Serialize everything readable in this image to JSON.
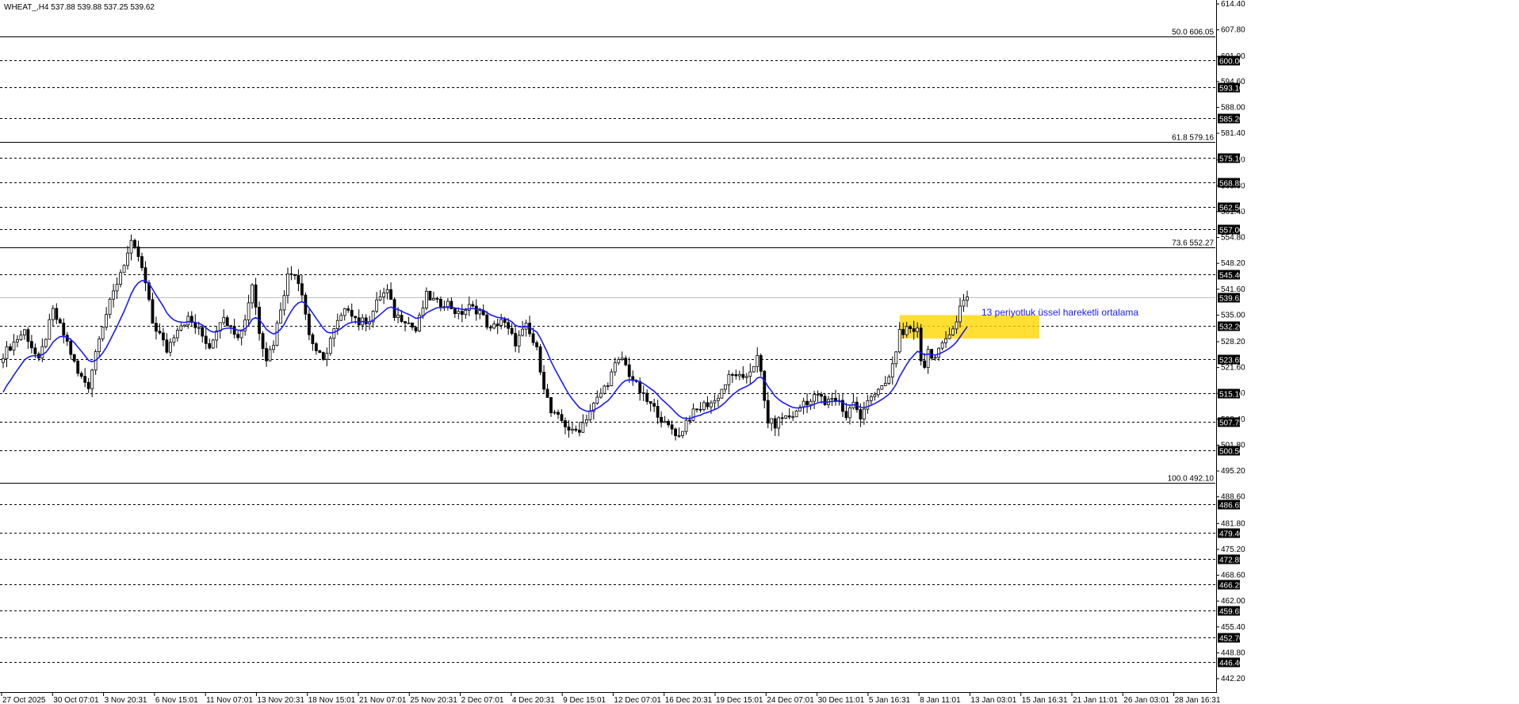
{
  "chart_data": {
    "type": "candlestick",
    "title": "WHEAT_,H4  537.88 539.88 537.25 539.62",
    "symbol": "WHEAT_,H4",
    "ohlc_readout": [
      "537.88",
      "539.88",
      "537.25",
      "539.62"
    ],
    "ylim": [
      442.0,
      614.4
    ],
    "price_axis_ticks": [
      "614.40",
      "607.80",
      "601.00",
      "594.60",
      "588.00",
      "581.40",
      "574.60",
      "568.00",
      "561.40",
      "554.80",
      "548.20",
      "541.60",
      "535.00",
      "528.20",
      "521.60",
      "515.00",
      "508.40",
      "501.80",
      "495.20",
      "488.60",
      "481.80",
      "475.20",
      "468.60",
      "462.00",
      "455.40",
      "448.80",
      "442.20"
    ],
    "x_tick_labels": [
      "27 Oct 2025",
      "30 Oct 07:01",
      "3 Nov 20:31",
      "6 Nov 15:01",
      "11 Nov 07:01",
      "13 Nov 20:31",
      "18 Nov 15:01",
      "21 Nov 07:01",
      "25 Nov 20:31",
      "2 Dec 07:01",
      "4 Dec 20:31",
      "9 Dec 15:01",
      "12 Dec 07:01",
      "16 Dec 20:31",
      "19 Dec 15:01",
      "24 Dec 07:01",
      "30 Dec 11:01",
      "5 Jan 16:31",
      "8 Jan 11:01",
      "13 Jan 03:01",
      "15 Jan 16:31",
      "21 Jan 11:01",
      "26 Jan 03:01",
      "28 Jan 16:31"
    ],
    "horizontal_levels": [
      {
        "label": "600.00",
        "value": 600.0
      },
      {
        "label": "593.10",
        "value": 593.1
      },
      {
        "label": "585.20",
        "value": 585.2
      },
      {
        "label": "575.10",
        "value": 575.1
      },
      {
        "label": "568.85",
        "value": 568.85
      },
      {
        "label": "562.50",
        "value": 562.5
      },
      {
        "label": "557.00",
        "value": 557.0
      },
      {
        "label": "545.40",
        "value": 545.4
      },
      {
        "label": "539.62",
        "value": 539.62
      },
      {
        "label": "532.20",
        "value": 532.2
      },
      {
        "label": "523.65",
        "value": 523.65
      },
      {
        "label": "515.10",
        "value": 515.1
      },
      {
        "label": "507.75",
        "value": 507.75
      },
      {
        "label": "500.50",
        "value": 500.5
      },
      {
        "label": "486.65",
        "value": 486.65
      },
      {
        "label": "479.40",
        "value": 479.4
      },
      {
        "label": "472.85",
        "value": 472.85
      },
      {
        "label": "466.25",
        "value": 466.25
      },
      {
        "label": "459.65",
        "value": 459.65
      },
      {
        "label": "452.70",
        "value": 452.7
      },
      {
        "label": "446.40",
        "value": 446.4
      }
    ],
    "fibonacci_levels": [
      {
        "label": "50.0 606.05",
        "value": 606.05
      },
      {
        "label": "61.8 579.16",
        "value": 579.16
      },
      {
        "label": "73.6 552.27",
        "value": 552.27
      },
      {
        "label": "100.0 492.10",
        "value": 492.1
      }
    ],
    "current_price": 539.62,
    "highlight_zone": {
      "price_low": 529.0,
      "price_high": 535.0,
      "color": "#ffd700"
    },
    "annotation": "13 periyotluk üssel hareketli ortalama",
    "ema_period": 13,
    "colors": {
      "ema": "#1a1aff",
      "annotation": "#1a1aff",
      "candle": "#000000",
      "zone": "#ffd700"
    },
    "price_path": [
      [
        0,
        525
      ],
      [
        6,
        531
      ],
      [
        10,
        523
      ],
      [
        14,
        536
      ],
      [
        18,
        528
      ],
      [
        21,
        520
      ],
      [
        24,
        517
      ],
      [
        27,
        530
      ],
      [
        30,
        538
      ],
      [
        33,
        546
      ],
      [
        36,
        553
      ],
      [
        38,
        550
      ],
      [
        40,
        543
      ],
      [
        42,
        533
      ],
      [
        44,
        530
      ],
      [
        46,
        526
      ],
      [
        49,
        532
      ],
      [
        52,
        534
      ],
      [
        55,
        531
      ],
      [
        58,
        527
      ],
      [
        61,
        534
      ],
      [
        64,
        533
      ],
      [
        66,
        529
      ],
      [
        68,
        534
      ],
      [
        70,
        543
      ],
      [
        72,
        531
      ],
      [
        74,
        524
      ],
      [
        76,
        528
      ],
      [
        78,
        537
      ],
      [
        80,
        545
      ],
      [
        82,
        546
      ],
      [
        84,
        541
      ],
      [
        86,
        530
      ],
      [
        88,
        526
      ],
      [
        90,
        523
      ],
      [
        92,
        529
      ],
      [
        94,
        533
      ],
      [
        97,
        537
      ],
      [
        100,
        533
      ],
      [
        103,
        534
      ],
      [
        106,
        540
      ],
      [
        108,
        541
      ],
      [
        110,
        535
      ],
      [
        113,
        534
      ],
      [
        116,
        531
      ],
      [
        119,
        540
      ],
      [
        122,
        538
      ],
      [
        125,
        538
      ],
      [
        128,
        535
      ],
      [
        131,
        537
      ],
      [
        134,
        536
      ],
      [
        137,
        531
      ],
      [
        140,
        534
      ],
      [
        142,
        531
      ],
      [
        144,
        528
      ],
      [
        147,
        532
      ],
      [
        150,
        526
      ],
      [
        152,
        517
      ],
      [
        154,
        510
      ],
      [
        157,
        508
      ],
      [
        160,
        505
      ],
      [
        162,
        506
      ],
      [
        164,
        509
      ],
      [
        166,
        512
      ],
      [
        168,
        515
      ],
      [
        170,
        518
      ],
      [
        172,
        522
      ],
      [
        174,
        524
      ],
      [
        176,
        520
      ],
      [
        178,
        517
      ],
      [
        180,
        514
      ],
      [
        182,
        512
      ],
      [
        184,
        510
      ],
      [
        186,
        507
      ],
      [
        188,
        506
      ],
      [
        190,
        504
      ],
      [
        192,
        508
      ],
      [
        194,
        510
      ],
      [
        197,
        512
      ],
      [
        200,
        513
      ],
      [
        202,
        516
      ],
      [
        204,
        519
      ],
      [
        206,
        520
      ],
      [
        208,
        518
      ],
      [
        210,
        521
      ],
      [
        212,
        524
      ],
      [
        213,
        520
      ],
      [
        214,
        513
      ],
      [
        215,
        508
      ],
      [
        217,
        507
      ],
      [
        219,
        509
      ],
      [
        221,
        509
      ],
      [
        223,
        510
      ],
      [
        225,
        513
      ],
      [
        227,
        513
      ],
      [
        229,
        515
      ],
      [
        231,
        512
      ],
      [
        233,
        514
      ],
      [
        235,
        513
      ],
      [
        237,
        509
      ],
      [
        239,
        513
      ],
      [
        241,
        508
      ],
      [
        243,
        514
      ],
      [
        245,
        515
      ],
      [
        247,
        516
      ],
      [
        249,
        519
      ],
      [
        250,
        522
      ],
      [
        251,
        526
      ],
      [
        252,
        531
      ],
      [
        254,
        531
      ],
      [
        256,
        530
      ],
      [
        257,
        532
      ],
      [
        258,
        524
      ],
      [
        259,
        522
      ],
      [
        260,
        526
      ],
      [
        262,
        524
      ],
      [
        264,
        527
      ],
      [
        266,
        531
      ],
      [
        268,
        533
      ],
      [
        269,
        537
      ],
      [
        270,
        539
      ],
      [
        271,
        539.62
      ]
    ]
  }
}
